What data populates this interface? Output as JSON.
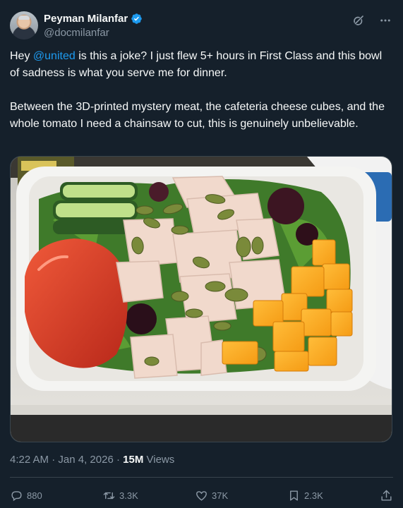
{
  "author": {
    "display_name": "Peyman Milanfar",
    "handle": "@docmilanfar",
    "verified": true
  },
  "icons": {
    "verified": "verified-badge-icon",
    "grok": "grok-icon",
    "more": "more-icon",
    "reply": "reply-icon",
    "repost": "repost-icon",
    "like": "like-icon",
    "bookmark": "bookmark-icon",
    "share": "share-icon"
  },
  "tweet": {
    "p1_before": "Hey ",
    "mention": "@united",
    "p1_after": " is this a joke? I just flew 5+ hours in First Class and this bowl of sadness is what you serve me for dinner.",
    "p2": "Between the 3D-printed mystery meat, the cafeteria cheese cubes, and the whole tomato I need a chainsaw to cut, this is genuinely unbelievable."
  },
  "meta": {
    "time": "4:22 AM",
    "date": "Jan 4, 2026",
    "separator": " · ",
    "views_count": "15M",
    "views_label": "Views"
  },
  "actions": {
    "replies": "880",
    "reposts": "3.3K",
    "likes": "37K",
    "bookmarks": "2.3K"
  },
  "colors": {
    "background": "#15202b",
    "accent": "#1d9bf0",
    "secondary_text": "#8b98a5",
    "primary_text": "#f7f9f9",
    "border": "#38444d"
  }
}
